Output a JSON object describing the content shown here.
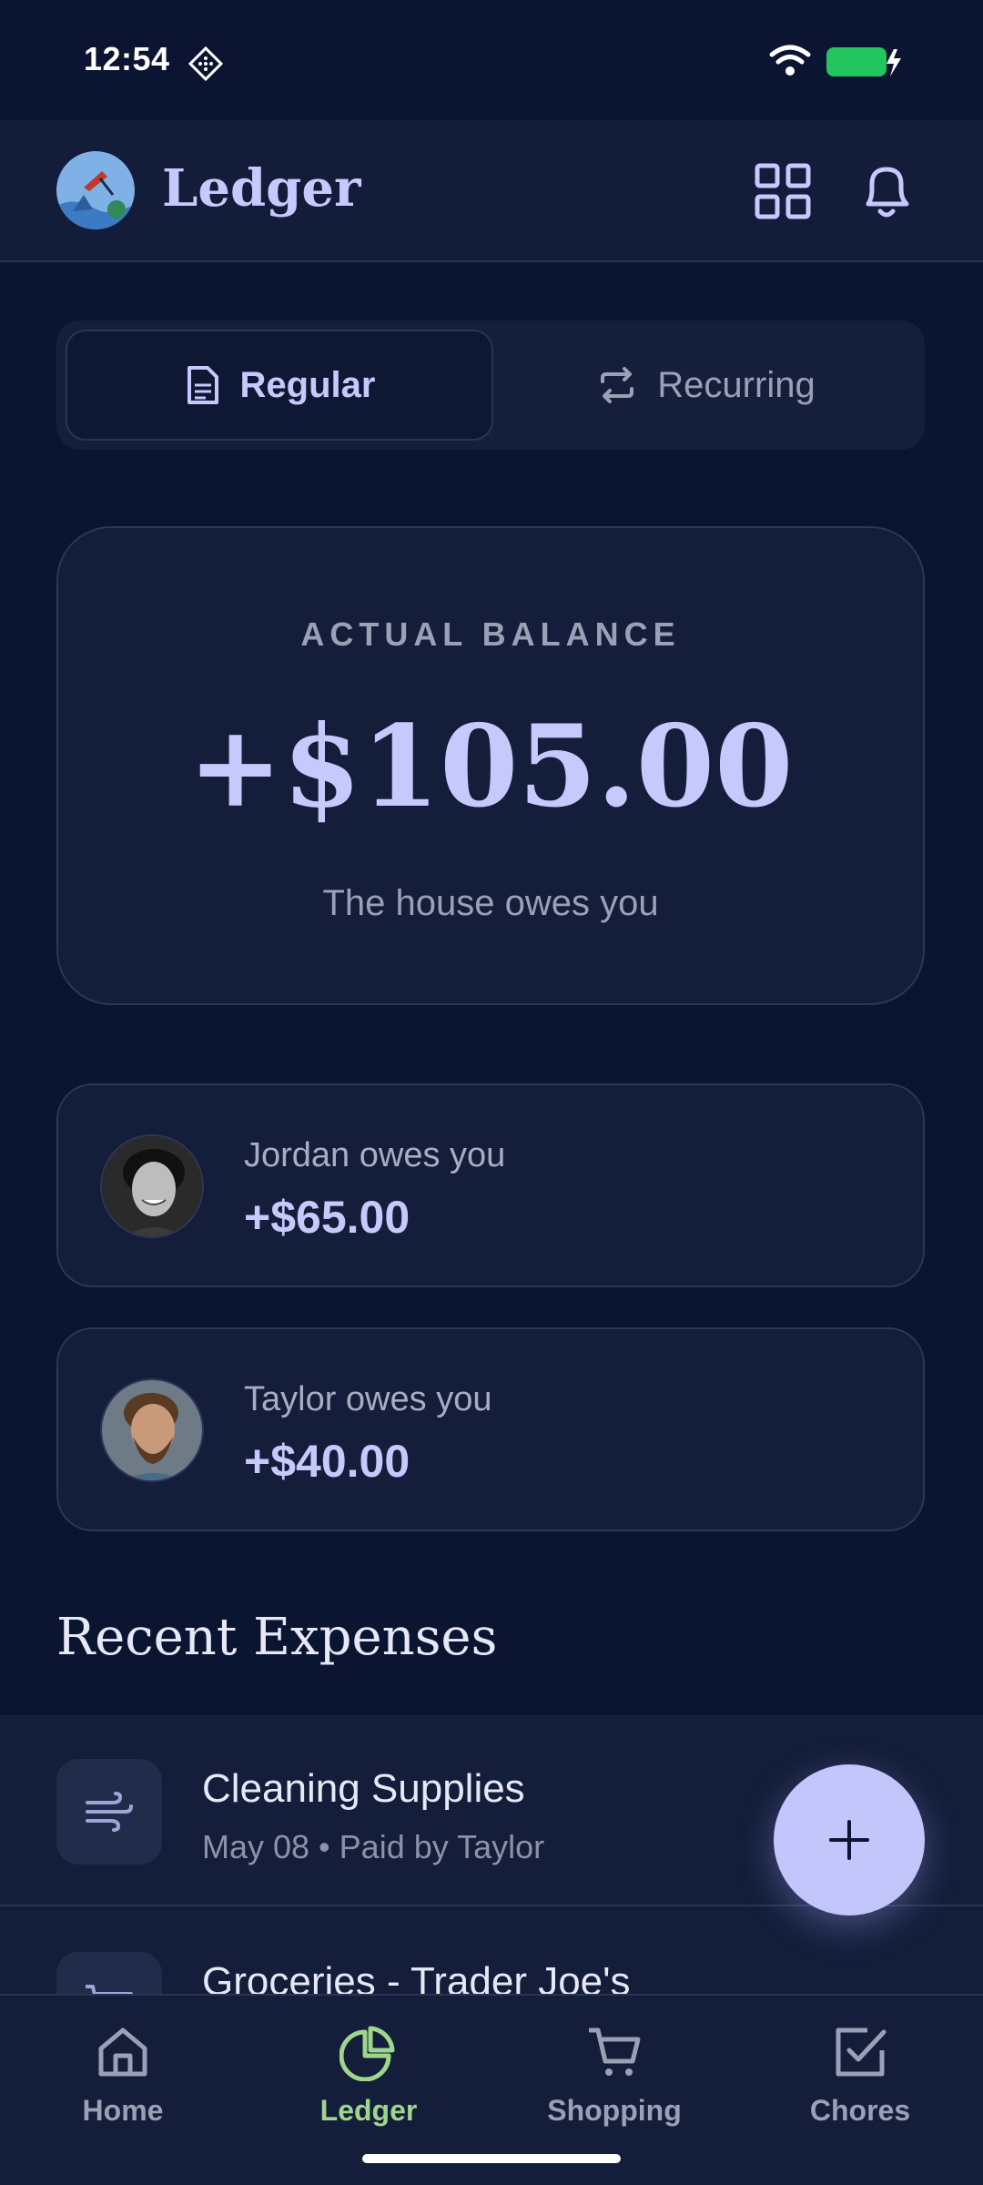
{
  "status_bar": {
    "time": "12:54",
    "icons": [
      "diamond-icon",
      "wifi-icon",
      "battery-charging-icon"
    ],
    "battery_color": "#22c55e"
  },
  "header": {
    "title": "Ledger",
    "icons": [
      "grid-icon",
      "bell-icon"
    ]
  },
  "segment": {
    "tabs": [
      {
        "label": "Regular",
        "icon": "document-icon",
        "active": true
      },
      {
        "label": "Recurring",
        "icon": "repeat-icon",
        "active": false
      }
    ]
  },
  "balance": {
    "label": "ACTUAL BALANCE",
    "amount": "+$105.00",
    "caption": "The house owes you"
  },
  "owes": [
    {
      "name": "Jordan owes you",
      "amount": "+$65.00"
    },
    {
      "name": "Taylor owes you",
      "amount": "+$40.00"
    }
  ],
  "recent": {
    "title": "Recent Expenses",
    "items": [
      {
        "title": "Cleaning Supplies",
        "meta": "May 08 • Paid by Taylor",
        "icon": "wind-icon"
      },
      {
        "title": "Groceries - Trader Joe's",
        "meta": "",
        "icon": "cart-icon"
      }
    ]
  },
  "fab": {
    "icon": "plus-icon"
  },
  "nav": {
    "items": [
      {
        "label": "Home",
        "icon": "home-icon",
        "active": false
      },
      {
        "label": "Ledger",
        "icon": "pie-chart-icon",
        "active": true
      },
      {
        "label": "Shopping",
        "icon": "cart-icon",
        "active": false
      },
      {
        "label": "Chores",
        "icon": "checkbox-icon",
        "active": false
      }
    ]
  },
  "colors": {
    "accent": "#c5c9fb",
    "active_nav": "#9ed68c",
    "background": "#0b1430",
    "card": "#141d39"
  }
}
